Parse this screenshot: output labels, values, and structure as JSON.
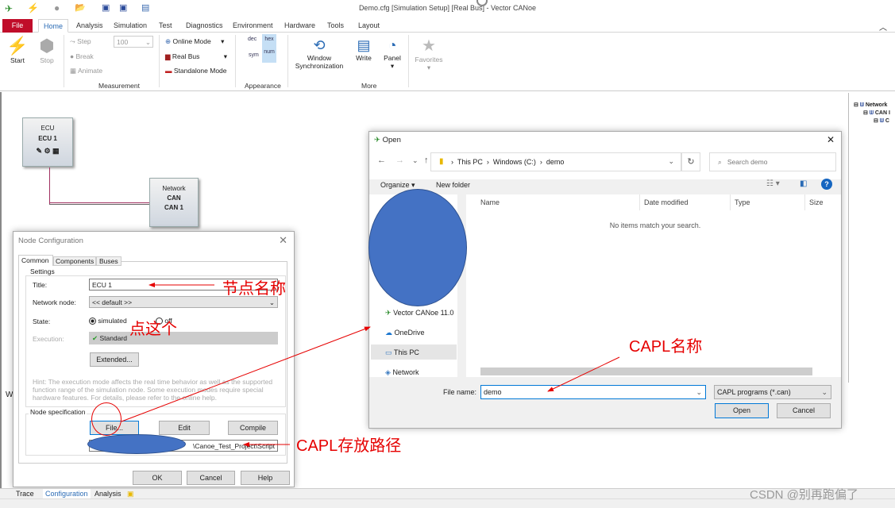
{
  "window": {
    "title": "Demo.cfg [Simulation Setup] [Real Bus] - Vector CANoe"
  },
  "ribbon_tabs": [
    "File",
    "Home",
    "Analysis",
    "Simulation",
    "Test",
    "Diagnostics",
    "Environment",
    "Hardware",
    "Tools",
    "Layout"
  ],
  "ribbon": {
    "start": "Start",
    "stop": "Stop",
    "step": "Step",
    "break": "Break",
    "animate": "Animate",
    "speed_value": "100",
    "online_mode": "Online Mode",
    "real_bus": "Real Bus",
    "standalone_mode": "Standalone Mode",
    "dec": "dec",
    "hex": "hex",
    "sym": "sym",
    "num": "num",
    "window_sync": "Window Synchronization",
    "write": "Write",
    "panel": "Panel",
    "favorites": "Favorites",
    "groups": {
      "measurement": "Measurement",
      "appearance": "Appearance",
      "more": "More"
    }
  },
  "canvas": {
    "ecu_node": {
      "line1": "ECU",
      "line2": "ECU 1"
    },
    "network_node": {
      "line1": "Network",
      "line2": "CAN",
      "line3": "CAN 1"
    },
    "right_tree": [
      "Network",
      "CAN I",
      "C"
    ],
    "partial_label": "Wr"
  },
  "node_config": {
    "title": "Node Configuration",
    "tabs": [
      "Common",
      "Components",
      "Buses"
    ],
    "settings_label": "Settings",
    "title_label": "Title:",
    "title_value": "ECU 1",
    "network_node_label": "Network node:",
    "network_node_value": "<< default >>",
    "state_label": "State:",
    "state_simulated": "simulated",
    "state_off": "off",
    "state_selected": "simulated",
    "execution_label": "Execution:",
    "execution_value": "Standard",
    "extended": "Extended...",
    "hint": "Hint: The execution mode affects the real time behavior as well as the supported function range of the simulation node. Some execution modes require special hardware features. For details, please refer to the online help.",
    "node_spec_label": "Node specification",
    "file": "File...",
    "edit": "Edit",
    "compile": "Compile",
    "path_value": "\\Canoe_Test_Project\\Script",
    "ok": "OK",
    "cancel": "Cancel",
    "help": "Help"
  },
  "open_dialog": {
    "title": "Open",
    "breadcrumb": [
      "This PC",
      "Windows (C:)",
      "demo"
    ],
    "search_placeholder": "Search demo",
    "organize": "Organize",
    "new_folder": "New folder",
    "columns": [
      "Name",
      "Date modified",
      "Type",
      "Size"
    ],
    "empty_message": "No items match your search.",
    "nav_items": [
      "Vector CANoe 11.0",
      "OneDrive",
      "This PC",
      "Network"
    ],
    "nav_selected": "This PC",
    "file_name_label": "File name:",
    "file_name_value": "demo",
    "file_type_value": "CAPL programs (*.can)",
    "open": "Open",
    "cancel": "Cancel"
  },
  "annotations": {
    "node_name": "节点名称",
    "click_this": "点这个",
    "capl_name": "CAPL名称",
    "capl_path": "CAPL存放路径",
    "color": "#e60000",
    "redaction_color": "#4472c4"
  },
  "bottom_tabs": [
    "Trace",
    "Configuration",
    "Analysis"
  ],
  "bottom_active": "Configuration",
  "watermark": "CSDN @别再跑偏了",
  "colors": {
    "file_tab": "#c00d2a",
    "accent": "#2a6bb5"
  }
}
